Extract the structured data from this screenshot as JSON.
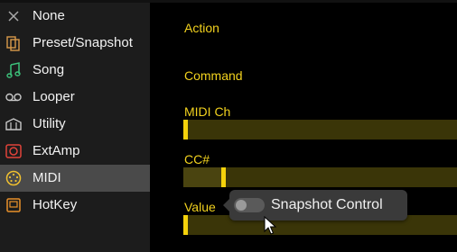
{
  "sidebar": {
    "items": [
      {
        "label": "None",
        "icon": "close-icon"
      },
      {
        "label": "Preset/Snapshot",
        "icon": "preset-snapshot-icon"
      },
      {
        "label": "Song",
        "icon": "music-note-icon"
      },
      {
        "label": "Looper",
        "icon": "looper-icon"
      },
      {
        "label": "Utility",
        "icon": "utility-icon"
      },
      {
        "label": "ExtAmp",
        "icon": "ext-amp-icon"
      },
      {
        "label": "MIDI",
        "icon": "midi-icon",
        "active": true
      },
      {
        "label": "HotKey",
        "icon": "hotkey-icon"
      }
    ]
  },
  "main": {
    "action_label": "Action",
    "command_label": "Command",
    "midi_ch_label": "MIDI Ch",
    "cc_label": "CC#",
    "value_label": "Value"
  },
  "tooltip": {
    "text": "Snapshot Control",
    "toggle_on": false
  },
  "colors": {
    "accent": "#f5d20b",
    "label": "#f2d21e",
    "track": "#3a3508",
    "active_row": "#4a4a4a"
  }
}
